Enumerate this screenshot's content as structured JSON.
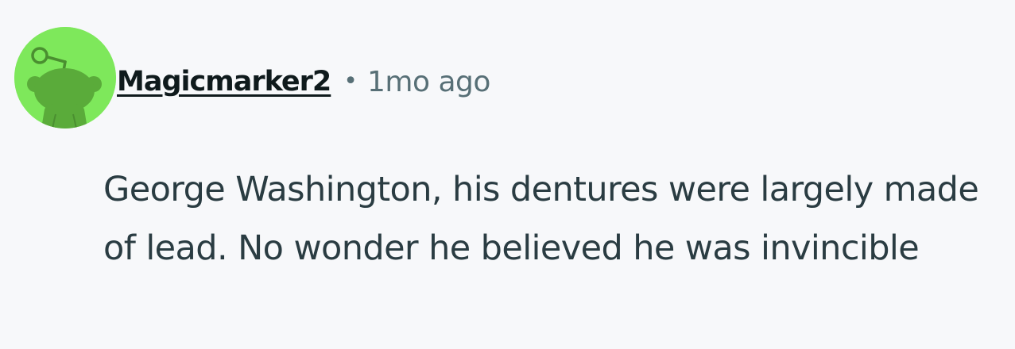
{
  "comment": {
    "author": "Magicmarker2",
    "separator": "•",
    "timestamp": "1mo ago",
    "body": "George Washington, his dentures were largely made of lead. No wonder he believed he was invincible",
    "avatar_icon": "snoo-avatar-icon"
  },
  "colors": {
    "background": "#f7f8fa",
    "avatar_bg": "#7ee85b",
    "avatar_figure": "#5aab3a",
    "username": "#0f1a1c",
    "meta": "#576f76",
    "body_text": "#2a3c42"
  }
}
